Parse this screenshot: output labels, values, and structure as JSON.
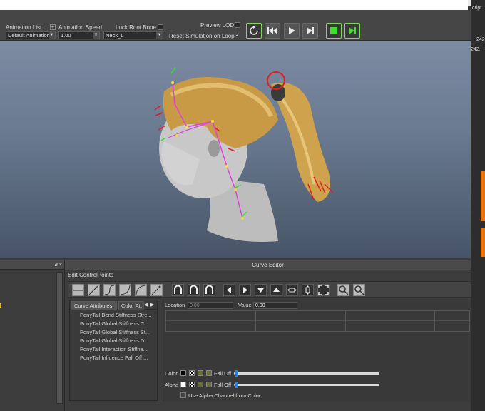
{
  "toolbar": {
    "animation_list_label": "Animation List",
    "animation_list_value": "Default Animatior",
    "animation_speed_label": "Animation Speed",
    "animation_speed_value": "1.00",
    "lock_root_bone_label": "Lock Root Bone",
    "lock_root_bone_value": "Neck_L",
    "preview_lod_label": "Preview LOD",
    "reset_sim_label": "Reset Simulation on Loop",
    "reset_sim_checked": "✓",
    "plus_symbol": "+"
  },
  "playback_buttons": [
    {
      "name": "loop-button",
      "icon": "loop-icon"
    },
    {
      "name": "rewind-button",
      "icon": "skip-back-icon"
    },
    {
      "name": "play-button",
      "icon": "play-icon"
    },
    {
      "name": "step-forward-button",
      "icon": "step-forward-icon"
    },
    {
      "name": "stop-button",
      "icon": "stop-icon"
    },
    {
      "name": "record-play-button",
      "icon": "play-green-icon"
    }
  ],
  "side_panel": {
    "text1": "cript",
    "text2": "242",
    "text3": "242,",
    "pin": "⌀ ×"
  },
  "curve_editor": {
    "title": "Curve Editor",
    "menu": "Edit  ControlPoints",
    "tabs": {
      "curve_attributes": "Curve Attributes",
      "color_attr": "Color Att"
    },
    "items": [
      "PonyTail.Bend Stiffness Stre...",
      "PonyTail.Global Stiffness C...",
      "PonyTail.Global Stiffness St...",
      "PonyTail.Global Stiffness D...",
      "PonyTail.Interaction Stiffne...",
      "PonyTail.Influence Fall Off ..."
    ],
    "location_label": "Location",
    "location_value": "0.00",
    "value_label": "Value",
    "value_value": "0.00",
    "color_label": "Color",
    "alpha_label": "Alpha",
    "fall_off_label": "Fall Off",
    "use_alpha_label": "Use Alpha Channel from Color"
  },
  "colors": {
    "accent_green": "#7ed957",
    "slider_blue": "#2f7fdc",
    "hair": "#d4a84a",
    "guide": "#e040e0"
  }
}
